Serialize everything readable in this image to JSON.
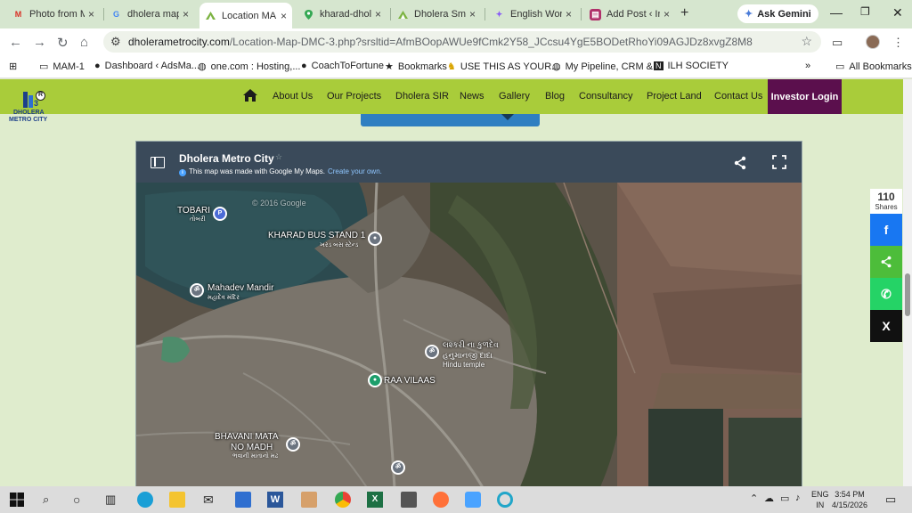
{
  "browser": {
    "tabs": [
      {
        "title": "Photo from M",
        "favicon": "gmail-icon",
        "color": "#d93025",
        "active": false
      },
      {
        "title": "dholera map",
        "favicon": "google-icon",
        "color": "#4285f4",
        "active": false
      },
      {
        "title": "Location MA",
        "favicon": "dholera-site-icon",
        "color": "#7cb342",
        "active": true
      },
      {
        "title": "kharad-dhole",
        "favicon": "maps-pin-icon",
        "color": "#34a853",
        "active": false
      },
      {
        "title": "Dholera Sma",
        "favicon": "dholera-site-icon",
        "color": "#7cb342",
        "active": false
      },
      {
        "title": "English Work",
        "favicon": "sparkle-icon",
        "color": "#8a5cf6",
        "active": false
      },
      {
        "title": "Add Post ‹ Inf",
        "favicon": "wordpress-icon",
        "color": "#b0306a",
        "active": false
      }
    ],
    "new_tab_label": "+",
    "gemini_label": "Ask Gemini",
    "url_domain": "dholerametrocity.com",
    "url_path": "/Location-Map-DMC-3.php?srsltid=AfmBOopAWUe9fCmk2Y58_JCcsu4YgE5BODetRhoYi09AGJDz8xvgZ8M8",
    "bookmarks": [
      {
        "label": "MAM-1",
        "icon": "folder-icon"
      },
      {
        "label": "Dashboard ‹ AdsMa...",
        "icon": "site-icon"
      },
      {
        "label": "one.com : Hosting,...",
        "icon": "globe-icon"
      },
      {
        "label": "CoachToFortune",
        "icon": "site-icon"
      },
      {
        "label": "Bookmarks",
        "icon": "star-icon"
      },
      {
        "label": "USE THIS AS YOUR...",
        "icon": "site-icon"
      },
      {
        "label": "My Pipeline, CRM &...",
        "icon": "site-icon"
      },
      {
        "label": "ILH SOCIETY",
        "icon": "site-icon"
      }
    ],
    "more_bookmarks": "»",
    "all_bookmarks_label": "All Bookmarks"
  },
  "site": {
    "logo_line1": "DHOLERA",
    "logo_line2": "METRO CITY",
    "logo_mark": "3",
    "logo_registered": "R",
    "nav": [
      "About Us",
      "Our Projects",
      "Dholera SIR",
      "News",
      "Gallery",
      "Blog",
      "Consultancy",
      "Project Land",
      "Contact Us"
    ],
    "investor_login": "Investor Login",
    "accent": "#a9cc3a",
    "investor_color": "#5b0f4d"
  },
  "map": {
    "title": "Dholera Metro City",
    "star": "☆",
    "note": "This map was made with Google My Maps.",
    "create_link": "Create your own.",
    "places": [
      {
        "name": "TOBARI",
        "sub": "તોબરી",
        "type": "parking-icon"
      },
      {
        "name": "KHARAD BUS STAND 1",
        "sub": "ખરડ બસ સ્ટેન્ડ",
        "type": "bus-stop-icon"
      },
      {
        "name": "Mahadev Mandir",
        "sub": "મહાદેવ મંદિર",
        "type": "temple-icon"
      },
      {
        "name": "લશ્કરી ના કુળદેવ",
        "sub": "હનુમાનજી દાદા",
        "name2": "Hindu temple",
        "type": "temple-icon"
      },
      {
        "name": "RAA VILAAS",
        "sub": "",
        "type": "place-icon"
      },
      {
        "name": "BHAVANI MATA",
        "name2": "NO MADH",
        "sub": "ભવાની માતાનો મઢ",
        "type": "temple-icon"
      }
    ],
    "watermark": "© 2016 Google"
  },
  "share": {
    "count": "110",
    "label": "Shares",
    "buttons": [
      {
        "name": "facebook",
        "glyph": "f",
        "color": "#1877f2"
      },
      {
        "name": "sharethis",
        "glyph": "<",
        "color": "#4dbd3a"
      },
      {
        "name": "whatsapp",
        "glyph": "✆",
        "color": "#25d366"
      },
      {
        "name": "x",
        "glyph": "X",
        "color": "#111111"
      }
    ]
  },
  "taskbar": {
    "lang1": "ENG",
    "lang2": "IN",
    "time": "3:54 PM",
    "date": "4/15/2026",
    "apps": [
      "start-icon",
      "search-icon",
      "cortana-icon",
      "task-view-icon",
      "edge-icon",
      "file-explorer-icon",
      "mail-icon",
      "paint-icon",
      "word-icon",
      "app-icon",
      "chrome-icon",
      "excel-icon",
      "calculator-icon",
      "firefox-icon",
      "app-icon",
      "app-icon"
    ]
  }
}
